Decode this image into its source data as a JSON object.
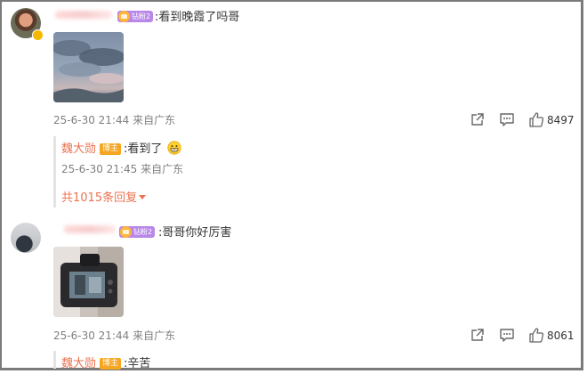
{
  "comments": [
    {
      "fan_badge": "钻粉2",
      "text": ":看到晚霞了吗哥",
      "time": "25-6-30 21:44",
      "location": "来自广东",
      "like_count": "8497",
      "reply": {
        "author": "魏大勋",
        "badge": "博主",
        "text": ":看到了",
        "emoji": "grinning-face-emoji",
        "time": "25-6-30 21:45",
        "location": "来自广东",
        "more_replies": "共1015条回复"
      }
    },
    {
      "fan_badge": "钻粉2",
      "text": ":哥哥你好厉害",
      "time": "25-6-30 21:44",
      "location": "来自广东",
      "like_count": "8061",
      "reply": {
        "author": "魏大勋",
        "badge": "博主",
        "text": ":辛苦"
      }
    }
  ],
  "icons": {
    "share": "share-icon",
    "comment": "comment-icon",
    "like": "thumbs-up-icon"
  },
  "colors": {
    "accent": "#eb7350",
    "badge": "#f5a623",
    "fans": "#b887e8",
    "meta": "#808080"
  }
}
